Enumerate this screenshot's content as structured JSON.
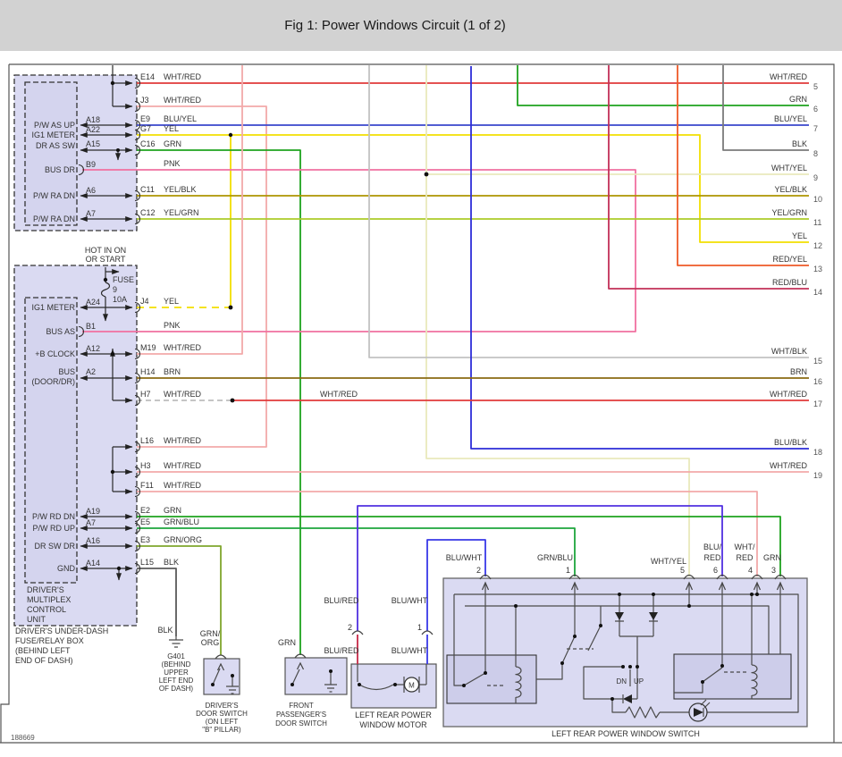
{
  "title": "Fig 1: Power Windows Circuit (1 of 2)",
  "footer_id": "188669",
  "colors": {
    "titlebar": "#d2d2d2",
    "box_fill": "#dadaf2",
    "box_fill_inner": "#d4d4ee",
    "relay_fill": "#cdcdea",
    "red": "#e03a3a",
    "pale_pink": "#f2a9a9",
    "pink": "#f170a0",
    "blu_yel": "#3a46cc",
    "blu_blk": "#2d2dd8",
    "blu_wht": "#3838e8",
    "blu_red": "#5030e0",
    "crimson": "#c62848",
    "grn": "#1ea31e",
    "grn_blu": "#1da53c",
    "grn_org": "#7fa62c",
    "yel": "#f2df00",
    "wht_yel": "#e9e9bc",
    "yel_blk": "#ad9400",
    "yel_grn": "#abcc28",
    "red_yel": "#ee5a28",
    "red_blu": "#c23058",
    "brn": "#8a6a12",
    "blk": "#5a5a5a",
    "blk2": "#7a7a7a",
    "wht_blk": "#c2c2c2",
    "wht_red_hidden": "#bdbdbd"
  },
  "hot_label": [
    "HOT IN ON",
    "OR START"
  ],
  "fuse": {
    "name": "FUSE",
    "num": "9",
    "amp": "10A"
  },
  "top_box": {
    "labels": [
      "P/W AS UP",
      "IG1 METER",
      "DR AS SW",
      "BUS DR",
      "P/W RA DN",
      "P/W RA DN"
    ],
    "pins": [
      "A18",
      "A22",
      "A15",
      "B9",
      "A6",
      "A7"
    ],
    "exits": [
      {
        "pin": "E14",
        "color": "WHT/RED"
      },
      {
        "pin": "J3",
        "color": "WHT/RED"
      },
      {
        "pin": "E9",
        "color": "BLU/YEL"
      },
      {
        "pin": "G7",
        "color": "YEL"
      },
      {
        "pin": "C16",
        "color": "GRN"
      },
      {
        "pin": "",
        "color": "PNK"
      },
      {
        "pin": "C11",
        "color": "YEL/BLK"
      },
      {
        "pin": "C12",
        "color": "YEL/GRN"
      }
    ]
  },
  "mid_box": {
    "labels": [
      "IG1 METER",
      "BUS AS",
      "+B CLOCK",
      "BUS",
      "(DOOR/DR)",
      "P/W RD DN",
      "P/W RD UP",
      "DR SW DR",
      "GND"
    ],
    "pins": [
      "A24",
      "B1",
      "A12",
      "A2",
      "A19",
      "A7",
      "A16",
      "A14"
    ],
    "exits": [
      {
        "pin": "J4",
        "color": "YEL"
      },
      {
        "pin": "",
        "color": "PNK"
      },
      {
        "pin": "M19",
        "color": "WHT/RED"
      },
      {
        "pin": "H14",
        "color": "BRN"
      },
      {
        "pin": "H7",
        "color": "WHT/RED"
      },
      {
        "pin": "L16",
        "color": "WHT/RED"
      },
      {
        "pin": "H3",
        "color": "WHT/RED"
      },
      {
        "pin": "F11",
        "color": "WHT/RED"
      },
      {
        "pin": "E2",
        "color": "GRN"
      },
      {
        "pin": "E5",
        "color": "GRN/BLU"
      },
      {
        "pin": "E3",
        "color": "GRN/ORG"
      },
      {
        "pin": "L15",
        "color": "BLK"
      }
    ],
    "unit_label": [
      "DRIVER'S",
      "MULTIPLEX",
      "CONTROL",
      "UNIT"
    ],
    "box_label": [
      "DRIVER'S UNDER-DASH",
      "FUSE/RELAY BOX",
      "(BEHIND LEFT",
      "END OF DASH)"
    ]
  },
  "right_rows": [
    {
      "n": "5",
      "label": "WHT/RED"
    },
    {
      "n": "6",
      "label": "GRN"
    },
    {
      "n": "7",
      "label": "BLU/YEL"
    },
    {
      "n": "8",
      "label": "BLK"
    },
    {
      "n": "9",
      "label": "WHT/YEL"
    },
    {
      "n": "10",
      "label": "YEL/BLK"
    },
    {
      "n": "11",
      "label": "YEL/GRN"
    },
    {
      "n": "12",
      "label": "YEL"
    },
    {
      "n": "13",
      "label": "RED/YEL"
    },
    {
      "n": "14",
      "label": "RED/BLU"
    },
    {
      "n": "15",
      "label": "WHT/BLK"
    },
    {
      "n": "16",
      "label": "BRN"
    },
    {
      "n": "17",
      "label": "WHT/RED"
    },
    {
      "n": "18",
      "label": "BLU/BLK"
    },
    {
      "n": "19",
      "label": "WHT/RED"
    }
  ],
  "mid_wire_label": "WHT/RED",
  "ground": {
    "wire": "BLK",
    "lines": [
      "G401",
      "(BEHIND",
      "UPPER",
      "LEFT END",
      "OF DASH)"
    ]
  },
  "driver_switch": {
    "wire1": "GRN/",
    "wire2": "ORG",
    "caption": [
      "DRIVER'S",
      "DOOR SWITCH",
      "(ON LEFT",
      "\"B\" PILLAR)"
    ]
  },
  "passenger_switch": {
    "wire": "GRN",
    "caption": [
      "FRONT",
      "PASSENGER'S",
      "DOOR SWITCH"
    ]
  },
  "motor": {
    "conn2": {
      "n": "2",
      "above": "BLU/RED",
      "below": "BLU/RED"
    },
    "conn1": {
      "n": "1",
      "above": "BLU/WHT",
      "below": "BLU/WHT"
    },
    "symbol": "M",
    "caption": [
      "LEFT REAR POWER",
      "WINDOW MOTOR"
    ]
  },
  "rear_switch": {
    "conn2": {
      "n": "2",
      "label": "BLU/WHT"
    },
    "conn1": {
      "n": "1",
      "label": "GRN/BLU"
    },
    "conn5": {
      "n": "5",
      "label": "WHT/YEL"
    },
    "conn6": {
      "n": "6",
      "l1": "BLU/",
      "l2": "RED"
    },
    "conn4": {
      "n": "4",
      "l1": "WHT/",
      "l2": "RED"
    },
    "conn3": {
      "n": "3",
      "label": "GRN"
    },
    "dn": "DN",
    "up": "UP",
    "caption": "LEFT REAR POWER WINDOW SWITCH"
  }
}
